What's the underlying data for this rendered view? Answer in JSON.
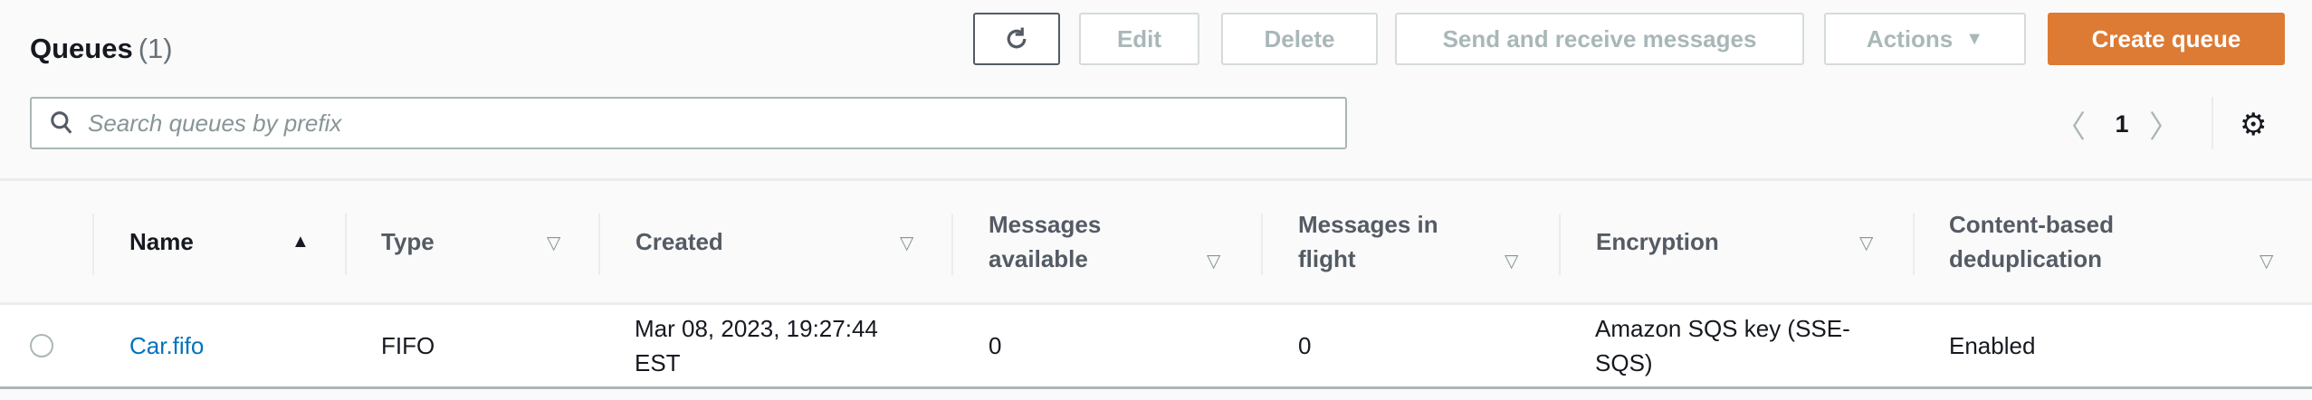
{
  "header": {
    "title": "Queues",
    "count": "(1)"
  },
  "toolbar": {
    "refresh_icon": "refresh-icon",
    "edit": "Edit",
    "delete": "Delete",
    "send_receive": "Send and receive messages",
    "actions": "Actions",
    "create": "Create queue"
  },
  "search": {
    "placeholder": "Search queues by prefix",
    "value": ""
  },
  "pagination": {
    "current_page": "1"
  },
  "colors": {
    "primary": "#dd7a33",
    "link": "#0073bb"
  },
  "table": {
    "columns": [
      {
        "label": "Name",
        "sort": "ascending"
      },
      {
        "label": "Type",
        "sort": "none"
      },
      {
        "label": "Created",
        "sort": "none"
      },
      {
        "label": "Messages available",
        "sort": "none"
      },
      {
        "label": "Messages in flight",
        "sort": "none"
      },
      {
        "label": "Encryption",
        "sort": "none"
      },
      {
        "label": "Content-based deduplication",
        "sort": "none"
      }
    ],
    "rows": [
      {
        "name": "Car.fifo",
        "type": "FIFO",
        "created": "Mar 08, 2023, 19:27:44 EST",
        "messages_available": "0",
        "messages_in_flight": "0",
        "encryption": "Amazon SQS key (SSE-SQS)",
        "dedup": "Enabled"
      }
    ]
  }
}
